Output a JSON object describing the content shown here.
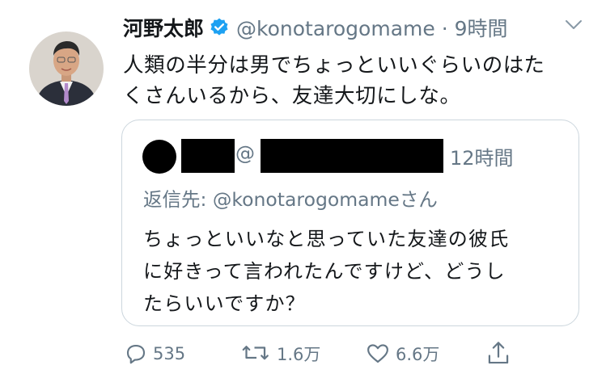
{
  "tweet": {
    "display_name": "河野太郎",
    "handle_time": "@konotarogomame · 9時間",
    "text_lines": [
      "人類の半分は男でちょっといいぐらいのはた",
      "くさんいるから、友達大切にしな。"
    ]
  },
  "quote": {
    "handle_prefix": "@",
    "time": "12時間",
    "reply_to": "返信先: @konotarogomameさん",
    "text_lines": [
      "ちょっといいなと思っていた友達の彼氏",
      "に好きって言われたんですけど、どうし",
      "たらいいですか？"
    ]
  },
  "actions": {
    "reply_count": "535",
    "retweet_count": "1.6万",
    "like_count": "6.6万"
  },
  "colors": {
    "verified": "#1da1f2",
    "secondary_text": "#657786",
    "border": "#ccd6dd"
  }
}
